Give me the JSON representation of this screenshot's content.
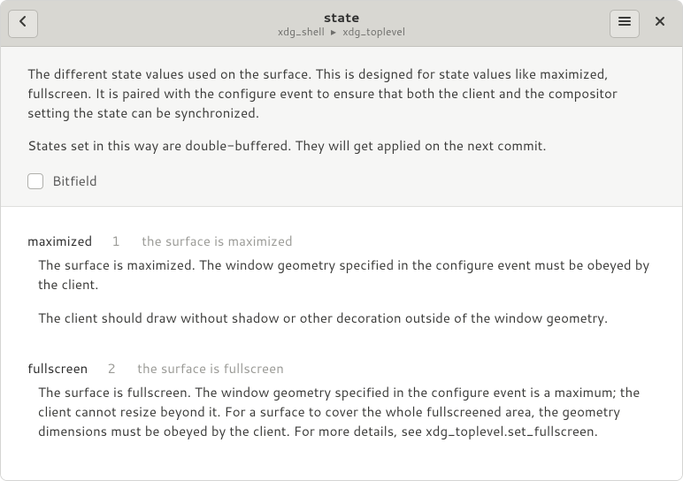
{
  "header": {
    "title": "state",
    "breadcrumb": [
      "xdg_shell",
      "xdg_toplevel"
    ],
    "breadcrumb_sep": "▸"
  },
  "intro": {
    "p1": "The different state values used on the surface. This is designed for state values like maximized, fullscreen. It is paired with the configure event to ensure that both the client and the compositor setting the state can be synchronized.",
    "p2": "States set in this way are double-buffered. They will get applied on the next commit.",
    "bitfield_label": "Bitfield"
  },
  "entries": [
    {
      "name": "maximized",
      "value": "1",
      "summary": "the surface is maximized",
      "desc_p1": "The surface is maximized. The window geometry specified in the configure   event must be obeyed by the client.",
      "desc_p2": "The client should draw without shadow or other   decoration outside of the window geometry."
    },
    {
      "name": "fullscreen",
      "value": "2",
      "summary": "the surface is fullscreen",
      "desc_p1": "The surface is fullscreen. The window geometry specified in the   configure event is a maximum; the client cannot resize beyond it. For   a surface to cover the whole fullscreened area, the geometry   dimensions must be obeyed by the client. For more details, see xdg_toplevel.set_fullscreen.",
      "desc_p2": ""
    }
  ]
}
